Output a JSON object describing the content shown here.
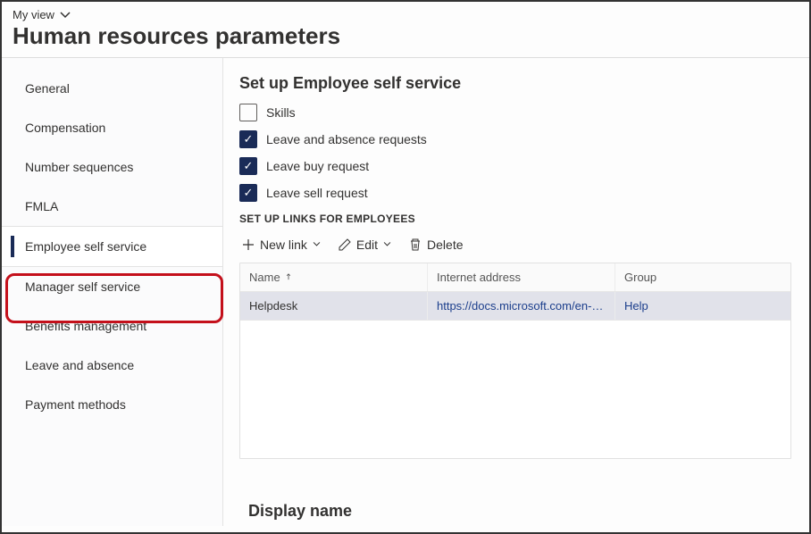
{
  "header": {
    "view_label": "My view",
    "page_title": "Human resources parameters"
  },
  "sidebar": {
    "items": [
      {
        "label": "General"
      },
      {
        "label": "Compensation"
      },
      {
        "label": "Number sequences"
      },
      {
        "label": "FMLA"
      },
      {
        "label": "Employee self service",
        "active": true
      },
      {
        "label": "Manager self service"
      },
      {
        "label": "Benefits management"
      },
      {
        "label": "Leave and absence"
      },
      {
        "label": "Payment methods"
      }
    ]
  },
  "main": {
    "section_title": "Set up Employee self service",
    "checkboxes": {
      "skills": {
        "label": "Skills",
        "checked": false
      },
      "leave_absence": {
        "label": "Leave and absence requests",
        "checked": true
      },
      "leave_buy": {
        "label": "Leave buy request",
        "checked": true
      },
      "leave_sell": {
        "label": "Leave sell request",
        "checked": true
      }
    },
    "links_subhead": "SET UP LINKS FOR EMPLOYEES",
    "toolbar": {
      "new_link": "New link",
      "edit": "Edit",
      "delete": "Delete"
    },
    "table": {
      "columns": {
        "name": "Name",
        "url": "Internet address",
        "group": "Group"
      },
      "rows": [
        {
          "name": "Helpdesk",
          "url": "https://docs.microsoft.com/en-u...",
          "group": "Help"
        }
      ]
    },
    "display_name_title": "Display name"
  }
}
